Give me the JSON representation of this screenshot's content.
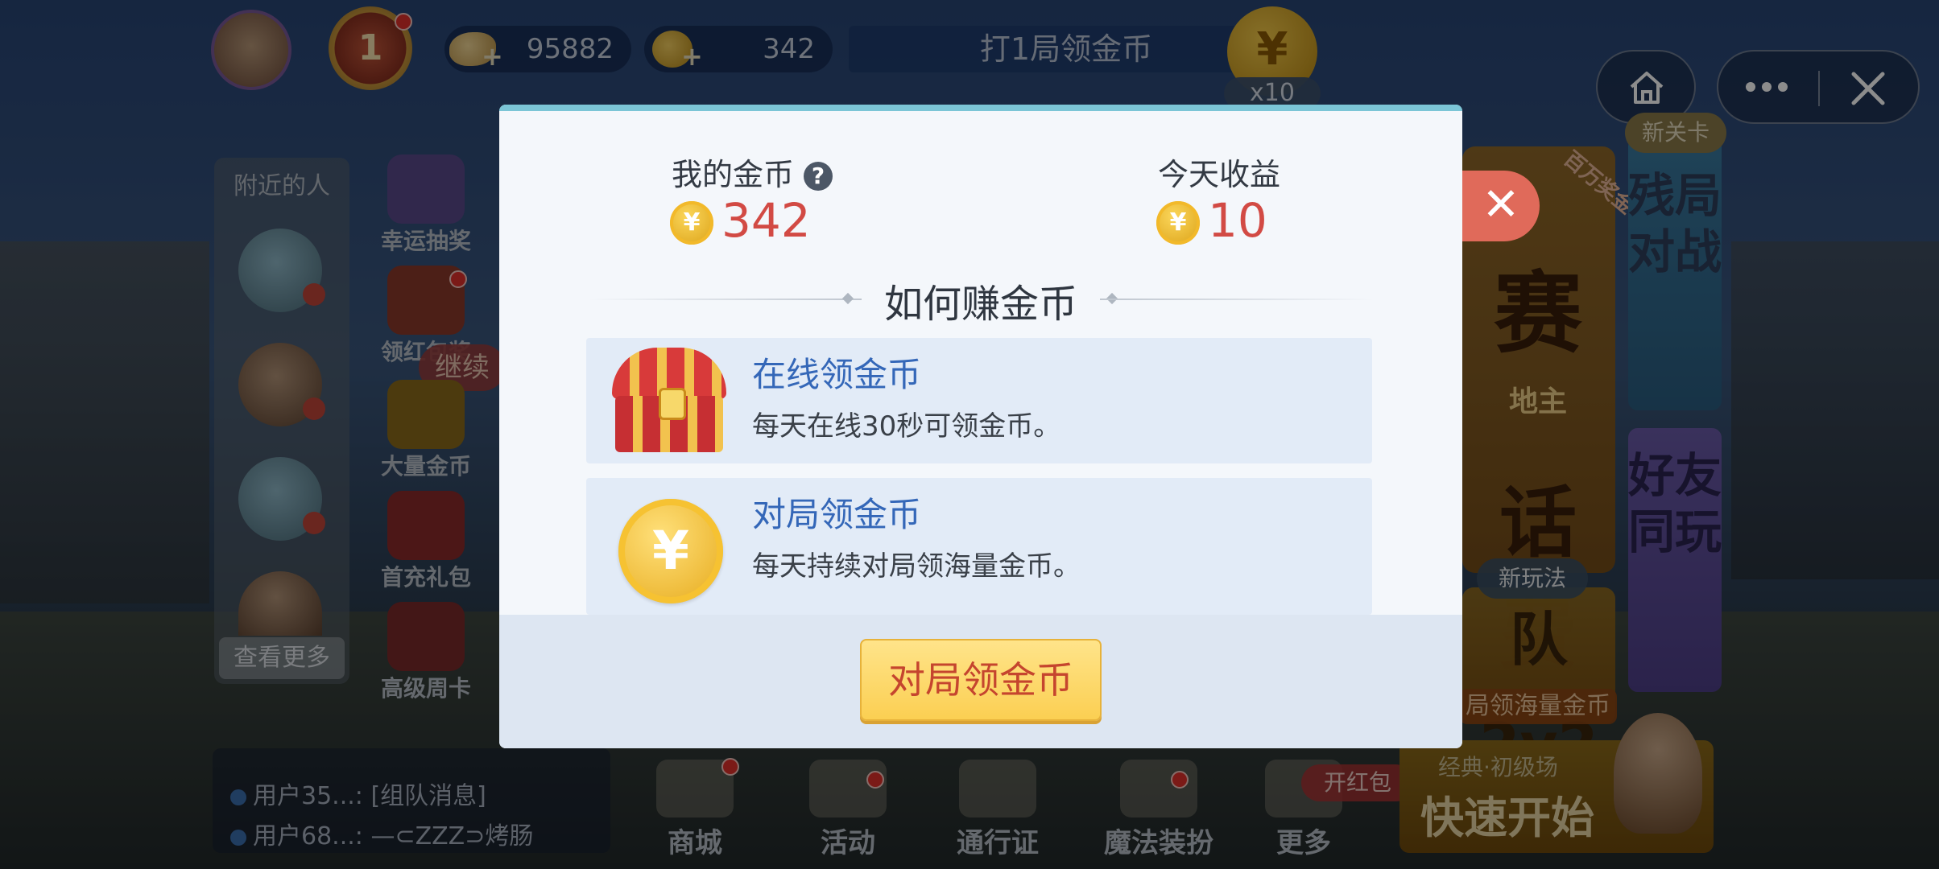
{
  "top_bar": {
    "rank_level": "1",
    "beans": "95882",
    "coins": "342",
    "task_text": "打1局领金币",
    "task_coin_symbol": "¥",
    "task_multiplier": "x10"
  },
  "capsule": {
    "home_icon": "home-icon",
    "more_icon": "more-dots-icon",
    "close_icon": "close-icon"
  },
  "nearby": {
    "title": "附近的人",
    "more": "查看更多"
  },
  "side_features": {
    "lucky_draw": "幸运抽奖",
    "red_packet": "领红包奖",
    "big_coins": "大量金币",
    "first_charge": "首充礼包",
    "weekly_card": "高级周卡",
    "continue": "继续"
  },
  "right_banners": {
    "big_tag": "百万奖金",
    "big_word_top": "赛",
    "big_word_mid": "地主",
    "big_word_bottom": "话费",
    "new_play_tag": "新玩法",
    "team_2v2": "队2v2",
    "team_2v2_sub": "局领海量金币",
    "new_level_tag": "新关卡",
    "endgame_tile": "残局对战",
    "friends_tile": "好友同玩"
  },
  "chat": {
    "lines": [
      {
        "user": "用户35...:",
        "msg": "[组队消息]"
      },
      {
        "user": "用户68...:",
        "msg": "—⊂ZZZ⊃烤肠"
      }
    ]
  },
  "bottom_nav": {
    "shop": "商城",
    "events": "活动",
    "pass": "通行证",
    "magic": "魔法装扮",
    "more": "更多",
    "red_pack_tag": "开红包"
  },
  "quick_start": {
    "subtitle": "经典·初级场",
    "label": "快速开始"
  },
  "modal": {
    "my_coins_label": "我的金币",
    "help_symbol": "?",
    "my_coins_value": "342",
    "today_label": "今天收益",
    "today_value": "10",
    "coin_symbol": "¥",
    "section_title": "如何赚金币",
    "cards": [
      {
        "title": "在线领金币",
        "desc": "每天在线30秒可领金币。",
        "icon": "treasure-chest-icon"
      },
      {
        "title": "对局领金币",
        "desc": "每天持续对局领海量金币。",
        "icon": "gold-coin-icon"
      }
    ],
    "cta_label": "对局领金币",
    "close_symbol": "✕"
  }
}
